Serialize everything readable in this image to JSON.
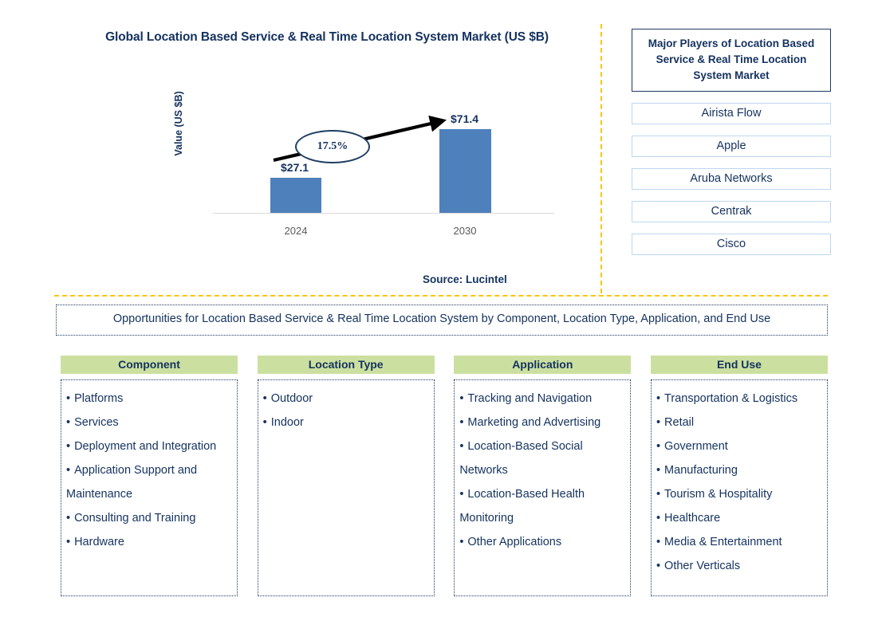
{
  "chart": {
    "title": "Global Location Based Service & Real Time Location System Market (US $B)",
    "ylabel": "Value (US $B)",
    "cagr_label": "17.5%",
    "value_2024": "$27.1",
    "value_2030": "$71.4",
    "tick_2024": "2024",
    "tick_2030": "2030",
    "source": "Source: Lucintel",
    "bar_color": "#4E80BC",
    "text_color": "#14325F",
    "divider_color": "#FFC20E"
  },
  "chart_data": {
    "type": "bar",
    "title": "Global Location Based Service & Real Time Location System Market (US $B)",
    "xlabel": "",
    "ylabel": "Value (US $B)",
    "categories": [
      "2024",
      "2030"
    ],
    "values": [
      27.1,
      71.4
    ],
    "data_labels": [
      "$27.1",
      "$71.4"
    ],
    "ylim": [
      0,
      75
    ],
    "grid": false,
    "legend": false,
    "annotations": [
      {
        "text": "17.5%",
        "type": "cagr-ellipse-with-arrow",
        "from": "2024",
        "to": "2030"
      }
    ],
    "source": "Source: Lucintel",
    "series_color": "#4E80BC"
  },
  "players": {
    "header": "Major Players of Location Based Service & Real Time Location System Market",
    "items": [
      "Airista Flow",
      "Apple",
      "Aruba Networks",
      "Centrak",
      "Cisco"
    ]
  },
  "opportunities": {
    "banner": "Opportunities for Location Based Service & Real Time Location System by Component, Location Type, Application, and End Use",
    "header_bg": "#CBE0A0",
    "columns": [
      {
        "header": "Component",
        "items": [
          "Platforms",
          "Services",
          "Deployment and Integration",
          "Application Support and Maintenance",
          "Consulting and Training",
          "Hardware"
        ]
      },
      {
        "header": "Location Type",
        "items": [
          "Outdoor",
          "Indoor"
        ]
      },
      {
        "header": "Application",
        "items": [
          "Tracking and Navigation",
          "Marketing and Advertising",
          "Location-Based Social Networks",
          "Location-Based Health Monitoring",
          "Other Applications"
        ]
      },
      {
        "header": "End Use",
        "items": [
          "Transportation & Logistics",
          "Retail",
          "Government",
          "Manufacturing",
          "Tourism & Hospitality",
          "Healthcare",
          "Media & Entertainment",
          "Other Verticals"
        ]
      }
    ]
  }
}
